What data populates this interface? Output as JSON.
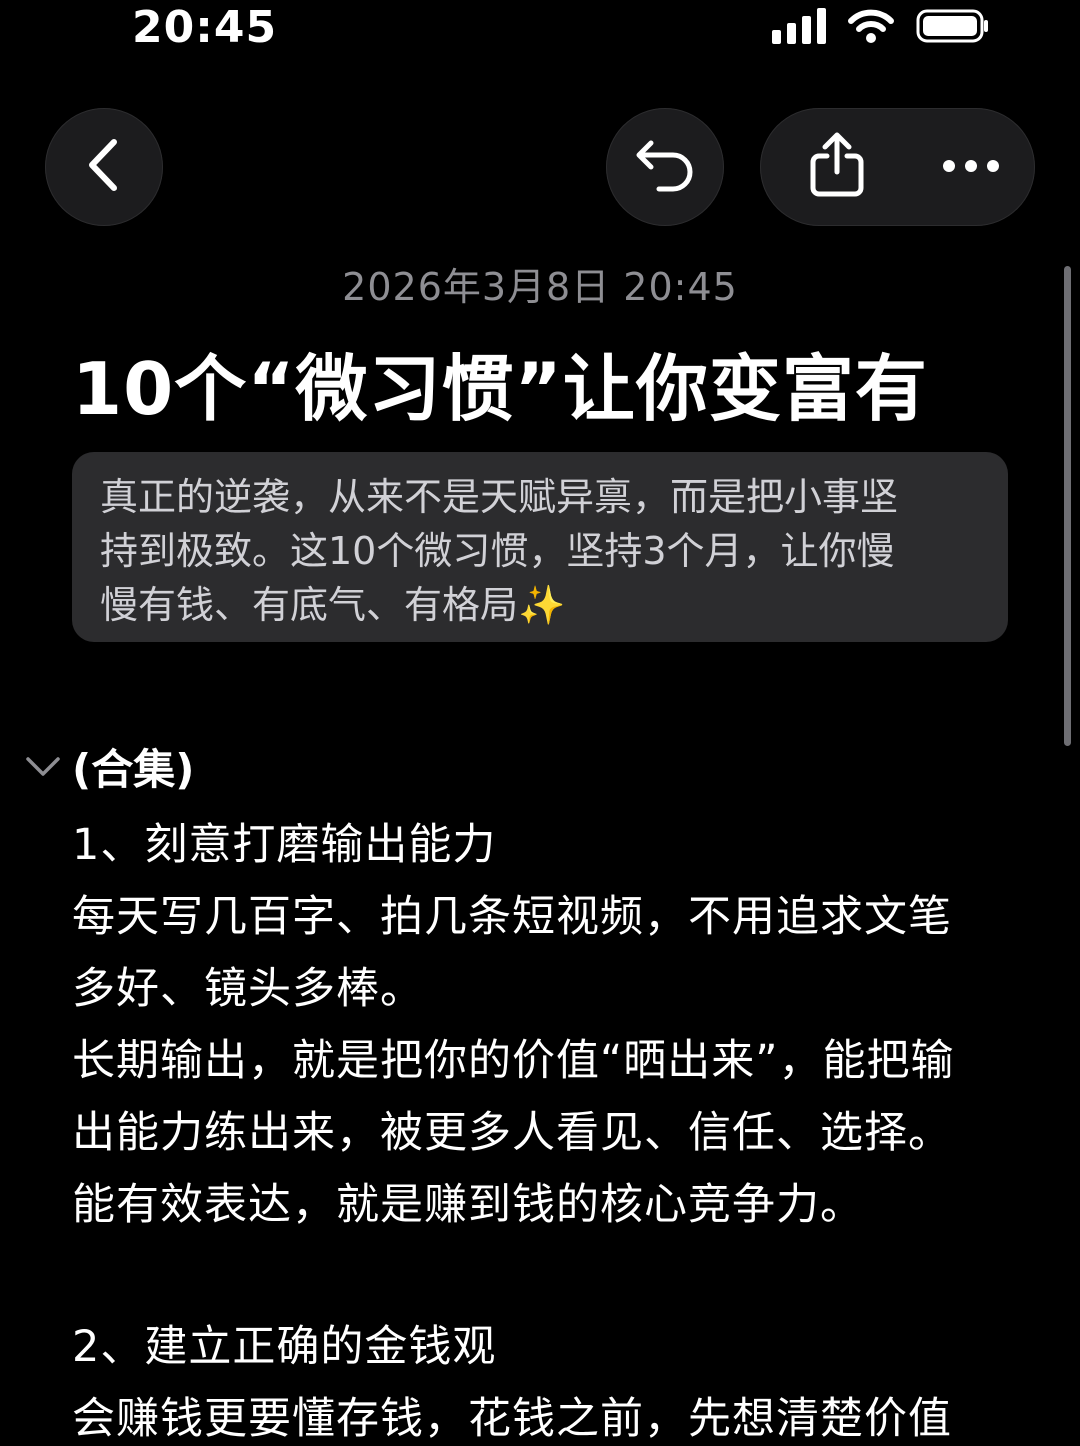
{
  "status_bar": {
    "time": "20:45",
    "icons": [
      "signal-icon",
      "wifi-icon",
      "battery-icon"
    ]
  },
  "toolbar": {
    "back_icon": "chevron-left-icon",
    "undo_icon": "undo-icon",
    "share_icon": "share-icon",
    "more_icon": "ellipsis-icon"
  },
  "note": {
    "date": "2026年3月8日 20:45",
    "title": "10个“微习惯”让你变富有",
    "intro_line1": "真正的逆袭，从来不是天赋异禀，而是把小事坚",
    "intro_line2": "持到极致。这10个微习惯，坚持3个月，让你慢",
    "intro_line3": "慢有钱、有底气、有格局✨",
    "section_heading": "(合集)",
    "lines": [
      "1、刻意打磨输出能力",
      "每天写几百字、拍几条短视频，不用追求文笔",
      "多好、镜头多棒。",
      "长期输出，就是把你的价值“晒出来”，能把输",
      "出能力练出来，被更多人看见、信任、选择。",
      "能有效表达，就是赚到钱的核心竞争力。",
      "2、建立正确的金钱观",
      "会赚钱更要懂存钱，花钱之前，先想清楚价值"
    ]
  },
  "colors": {
    "background": "#000000",
    "button_bg": "#1c1c1e",
    "intro_bg": "#2c2c2e",
    "muted_text": "#8e8e93",
    "primary_text": "#ffffff"
  }
}
